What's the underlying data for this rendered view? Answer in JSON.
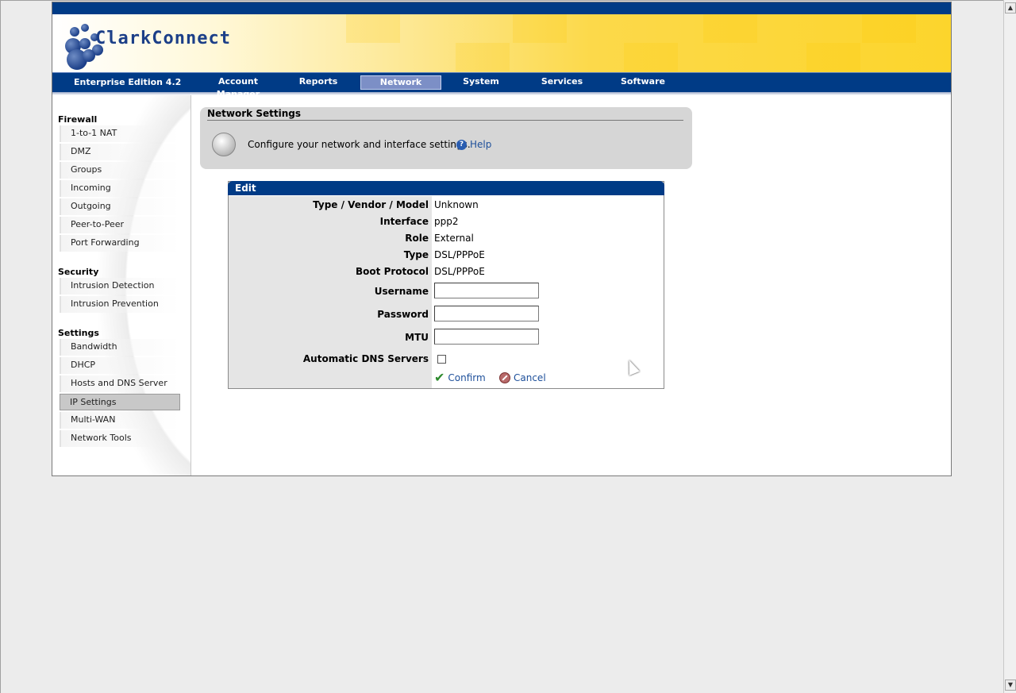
{
  "logo": {
    "text": "ClarkConnect"
  },
  "nav": {
    "edition": "Enterprise Edition 4.2",
    "tabs": [
      {
        "label": "Account Manager",
        "active": false
      },
      {
        "label": "Reports",
        "active": false
      },
      {
        "label": "Network",
        "active": true
      },
      {
        "label": "System",
        "active": false
      },
      {
        "label": "Services",
        "active": false
      },
      {
        "label": "Software",
        "active": false
      }
    ]
  },
  "sidebar": {
    "sections": [
      {
        "heading": "Firewall",
        "items": [
          "1-to-1 NAT",
          "DMZ",
          "Groups",
          "Incoming",
          "Outgoing",
          "Peer-to-Peer",
          "Port Forwarding"
        ]
      },
      {
        "heading": "Security",
        "items": [
          "Intrusion Detection",
          "Intrusion Prevention"
        ]
      },
      {
        "heading": "Settings",
        "items": [
          "Bandwidth",
          "DHCP",
          "Hosts and DNS Server",
          "IP Settings",
          "Multi-WAN",
          "Network Tools"
        ]
      }
    ],
    "active_item": "IP Settings"
  },
  "settings": {
    "title": "Network Settings",
    "description": "Configure your network and interface settings.",
    "help_label": "Help"
  },
  "edit": {
    "header": "Edit",
    "fields": [
      {
        "label": "Type / Vendor / Model",
        "value": "Unknown"
      },
      {
        "label": "Interface",
        "value": "ppp2"
      },
      {
        "label": "Role",
        "value": "External"
      },
      {
        "label": "Type",
        "value": "DSL/PPPoE"
      },
      {
        "label": "Boot Protocol",
        "value": "DSL/PPPoE"
      }
    ],
    "username_label": "Username",
    "username_value": "",
    "password_label": "Password",
    "password_value": "",
    "mtu_label": "MTU",
    "mtu_value": "",
    "auto_dns_label": "Automatic DNS Servers",
    "auto_dns_checked": false,
    "confirm_label": "Confirm",
    "cancel_label": "Cancel"
  },
  "colors": {
    "nav_blue": "#003b86",
    "banner_yellow": "#fcd52c",
    "link_blue": "#1d4f9a"
  }
}
